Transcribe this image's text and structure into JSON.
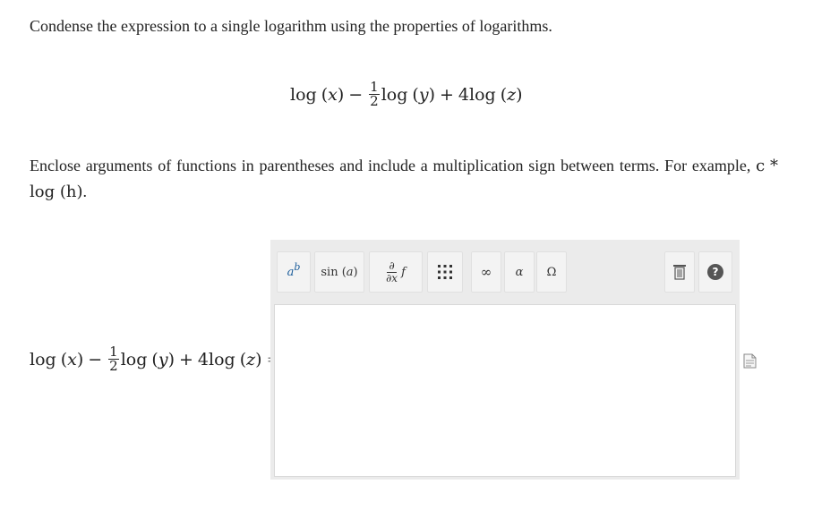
{
  "instruction": "Condense the expression to a single logarithm using the properties of logarithms.",
  "expression": {
    "t1_fn": "log",
    "t1_arg": "x",
    "op1": "−",
    "frac_num": "1",
    "frac_den": "2",
    "t2_fn": "log",
    "t2_arg": "y",
    "op2": "+",
    "coef": "4",
    "t3_fn": "log",
    "t3_arg": "z"
  },
  "note": {
    "text": "Enclose arguments of functions in parentheses and include a multiplication sign between terms. For example,",
    "example_c": "c",
    "example_star": "*",
    "example_fn": "log",
    "example_arg": "h",
    "period": "."
  },
  "answer_equals": "=",
  "toolbar": {
    "superscript_base": "a",
    "superscript_exp": "b",
    "sin_fn": "sin",
    "sin_arg": "a",
    "deriv_num": "∂",
    "deriv_den": "∂x",
    "deriv_f": "f",
    "infinity": "∞",
    "alpha": "α",
    "omega": "Ω",
    "help": "?"
  },
  "answer_value": ""
}
